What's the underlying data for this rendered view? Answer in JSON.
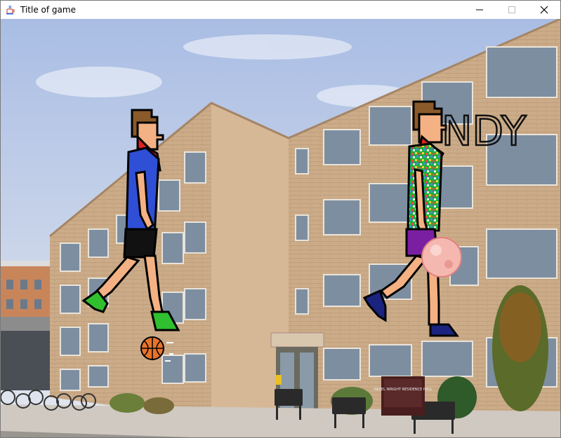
{
  "window": {
    "title": "Title of game",
    "app_icon": "java-coffee-cup-icon",
    "controls": [
      "minimize-icon",
      "maximize-icon",
      "close-icon"
    ]
  },
  "scene": {
    "background": "college-dormitory-building-photo",
    "sign_text": "HAZEL WRIGHT RESIDENCE HALL",
    "player_one": {
      "shirt_color": "#2f4fd6",
      "shorts_color": "#111111",
      "shoe_color": "#2fbf2f",
      "has_ball": true
    },
    "player_two": {
      "shirt_pattern": "multicolor-confetti",
      "shorts_color": "#7b1fa2",
      "shoe_color": "#1a237e",
      "name_label": "NDY"
    }
  },
  "colors": {
    "sky": "#b9c8e6",
    "brick": "#c8a886",
    "ball": "#e8742a"
  }
}
